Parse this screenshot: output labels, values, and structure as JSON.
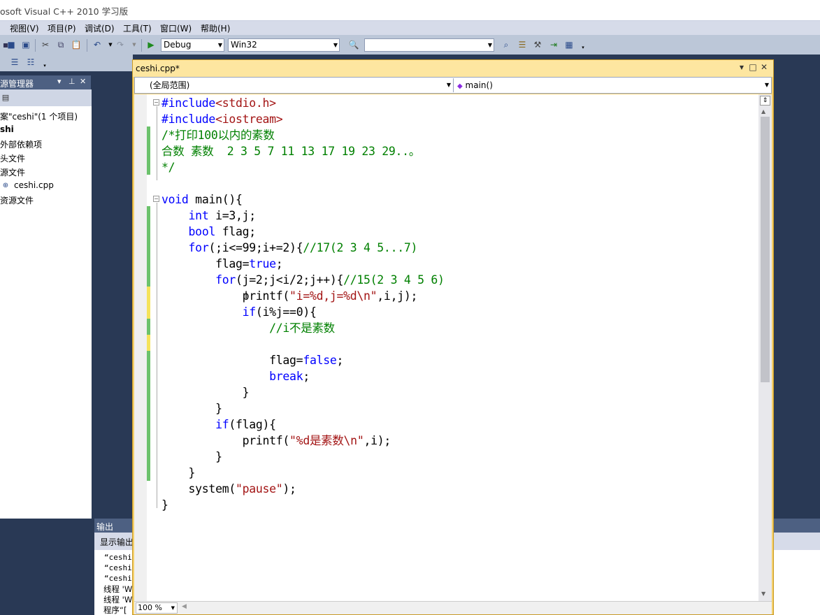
{
  "app": {
    "title": "osoft Visual C++ 2010 学习版"
  },
  "menu": {
    "view": "视图(V)",
    "project": "项目(P)",
    "debug": "调试(D)",
    "tools": "工具(T)",
    "window": "窗口(W)",
    "help": "帮助(H)"
  },
  "toolbar": {
    "config": "Debug",
    "platform": "Win32",
    "find_value": ""
  },
  "solution_explorer": {
    "title": "源管理器",
    "items": [
      "案\"ceshi\"(1 个项目)",
      "shi",
      "外部依赖项",
      "头文件",
      "源文件",
      "ceshi.cpp",
      "资源文件"
    ]
  },
  "output": {
    "title": "输出",
    "show_label": "显示输出",
    "lines": [
      "“ceshi",
      "“ceshi",
      "“ceshi",
      "线程 'W",
      "线程 'W",
      "程序“["
    ]
  },
  "editor": {
    "tab_title": "ceshi.cpp*",
    "scope": "(全局范围)",
    "member": "main()",
    "zoom": "100 %",
    "code": [
      "#include<stdio.h>",
      "#include<iostream>",
      "/*打印100以内的素数",
      "合数 素数  2 3 5 7 11 13 17 19 23 29..。",
      "*/",
      "",
      "void main(){",
      "    int i=3,j;",
      "    bool flag;",
      "    for(;i<=99;i+=2){//17(2 3 4 5...7)",
      "        flag=true;",
      "        for(j=2;j<i/2;j++){//15(2 3 4 5 6)",
      "            printf(\"i=%d,j=%d\\n\",i,j);",
      "            if(i%j==0){",
      "                //i不是素数",
      "",
      "                flag=false;",
      "                break;",
      "            }",
      "        }",
      "        if(flag){",
      "            printf(\"%d是素数\\n\",i);",
      "        }",
      "    }",
      "    system(\"pause\");",
      "}"
    ]
  }
}
